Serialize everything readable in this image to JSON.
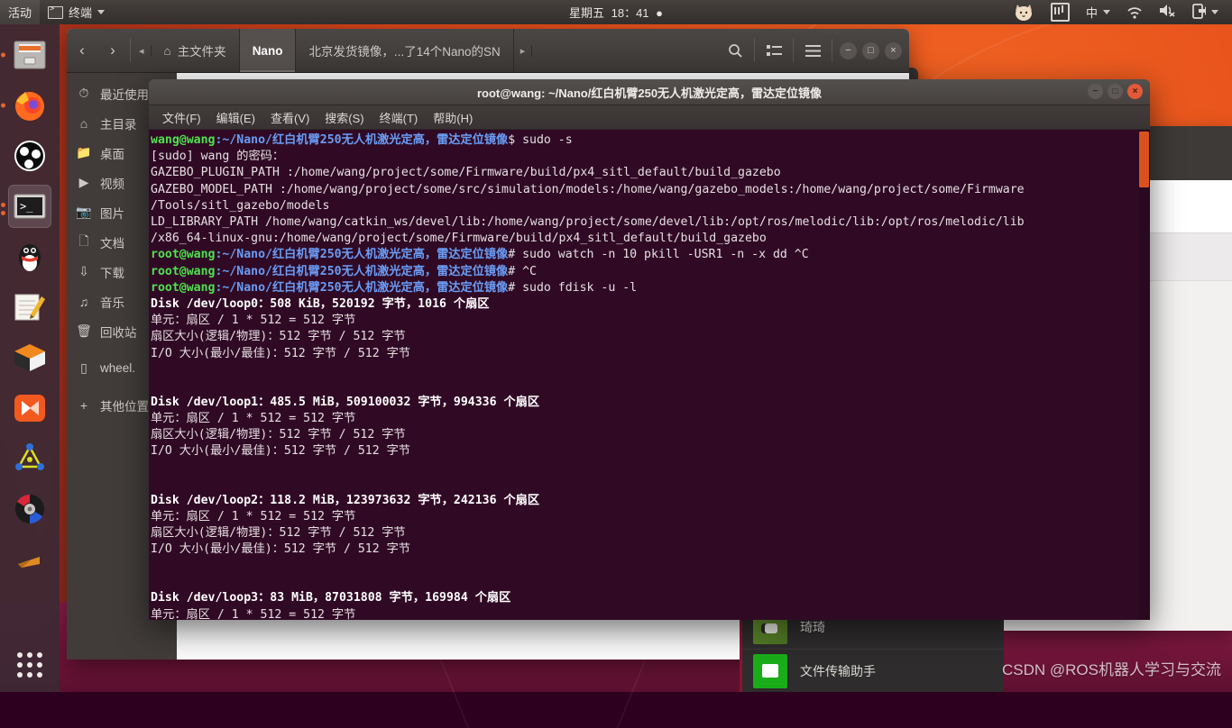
{
  "topbar": {
    "activities": "活动",
    "app_indicator": {
      "icon": "terminal-icon",
      "label": "终端"
    },
    "clock": {
      "weekday": "星期五",
      "time": "18：41"
    },
    "indicators": [
      {
        "name": "cat-tray-icon",
        "label": ""
      },
      {
        "name": "keyboard-layout-icon",
        "label": ""
      },
      {
        "name": "input-method-icon",
        "label": "中"
      },
      {
        "name": "wifi-icon",
        "label": ""
      },
      {
        "name": "volume-muted-icon",
        "label": ""
      },
      {
        "name": "power-menu-icon",
        "label": ""
      }
    ]
  },
  "dock": {
    "items": [
      {
        "name": "files-icon",
        "label": "文件管理器",
        "running": true
      },
      {
        "name": "firefox-icon",
        "label": "Firefox",
        "running": true
      },
      {
        "name": "obs-icon",
        "label": "OBS Studio",
        "running": false
      },
      {
        "name": "terminal-icon",
        "label": "终端",
        "running": true,
        "active": true
      },
      {
        "name": "qq-icon",
        "label": "QQ",
        "running": false
      },
      {
        "name": "notes-icon",
        "label": "备忘录",
        "running": false
      },
      {
        "name": "virtualbox-icon",
        "label": "VirtualBox",
        "running": false
      },
      {
        "name": "media-player-icon",
        "label": "影音先锋",
        "running": false
      },
      {
        "name": "molecule-icon",
        "label": "分子编辑器",
        "running": false
      },
      {
        "name": "disk-burner-icon",
        "label": "光盘刻录",
        "running": false
      },
      {
        "name": "unknown-app-icon",
        "label": "应用",
        "running": false
      }
    ],
    "show_apps": "显示应用程序"
  },
  "file_manager": {
    "nav": {
      "back": "‹",
      "forward": "›",
      "tabs_left": "◂",
      "tabs_right": "▸"
    },
    "tabs": [
      {
        "label": "主文件夹",
        "icon": "home-icon",
        "selected": false
      },
      {
        "label": "Nano",
        "icon": "",
        "selected": true
      },
      {
        "label": "北京发货镜像，...了14个Nano的SN",
        "icon": "",
        "selected": false
      }
    ],
    "toolbar": [
      {
        "name": "search-icon",
        "label": "搜索"
      },
      {
        "name": "view-list-icon",
        "label": "视图"
      },
      {
        "name": "hamburger-menu-icon",
        "label": "菜单"
      }
    ],
    "window_buttons": {
      "minimize": "−",
      "maximize": "□",
      "close": "×"
    },
    "sidebar": [
      {
        "icon": "recent-icon",
        "label": "最近使用"
      },
      {
        "icon": "home-icon",
        "label": "主目录"
      },
      {
        "icon": "desktop-icon",
        "label": "桌面"
      },
      {
        "icon": "video-icon",
        "label": "视频"
      },
      {
        "icon": "pictures-icon",
        "label": "图片"
      },
      {
        "icon": "documents-icon",
        "label": "文档"
      },
      {
        "icon": "downloads-icon",
        "label": "下载"
      },
      {
        "icon": "music-icon",
        "label": "音乐"
      },
      {
        "icon": "trash-icon",
        "label": "回收站"
      },
      {
        "icon": "drive-icon",
        "label": "wheel."
      },
      {
        "icon": "plus-icon",
        "label": "其他位置"
      }
    ]
  },
  "terminal": {
    "title": "root@wang: ~/Nano/红白机臂250无人机激光定高，雷达定位镜像",
    "window_buttons": {
      "minimize": "−",
      "maximize": "□",
      "close": "×"
    },
    "menus": [
      "文件(F)",
      "编辑(E)",
      "查看(V)",
      "搜索(S)",
      "终端(T)",
      "帮助(H)"
    ],
    "prompt_user": "wang@wang",
    "prompt_root": "root@wang",
    "prompt_path": ":~/Nano/",
    "prompt_path_cn": "红白机臂250无人机激光定高，雷达定位镜像",
    "lines": [
      {
        "type": "prompt-user",
        "user": "wang@wang",
        "sep": ":~/Nano/",
        "path": "红白机臂250无人机激光定高，雷达定位镜像",
        "tail": "$ sudo -s"
      },
      {
        "type": "out",
        "text": "[sudo] wang 的密码："
      },
      {
        "type": "out",
        "text": "GAZEBO_PLUGIN_PATH :/home/wang/project/some/Firmware/build/px4_sitl_default/build_gazebo"
      },
      {
        "type": "out",
        "text": "GAZEBO_MODEL_PATH :/home/wang/project/some/src/simulation/models:/home/wang/gazebo_models:/home/wang/project/some/Firmware"
      },
      {
        "type": "out",
        "text": "/Tools/sitl_gazebo/models"
      },
      {
        "type": "out",
        "text": "LD_LIBRARY_PATH /home/wang/catkin_ws/devel/lib:/home/wang/project/some/devel/lib:/opt/ros/melodic/lib:/opt/ros/melodic/lib"
      },
      {
        "type": "out",
        "text": "/x86_64-linux-gnu:/home/wang/project/some/Firmware/build/px4_sitl_default/build_gazebo"
      },
      {
        "type": "prompt-root",
        "user": "root@wang",
        "sep": ":~/Nano/",
        "path": "红白机臂250无人机激光定高，雷达定位镜像",
        "tail": "# sudo watch -n 10 pkill -USR1 -n -x dd ^C"
      },
      {
        "type": "prompt-root",
        "user": "root@wang",
        "sep": ":~/Nano/",
        "path": "红白机臂250无人机激光定高，雷达定位镜像",
        "tail": "# ^C"
      },
      {
        "type": "prompt-root",
        "user": "root@wang",
        "sep": ":~/Nano/",
        "path": "红白机臂250无人机激光定高，雷达定位镜像",
        "tail": "# sudo fdisk -u -l"
      },
      {
        "type": "bold",
        "text": "Disk /dev/loop0：508 KiB，520192 字节，1016 个扇区"
      },
      {
        "type": "out",
        "text": "单元：扇区 / 1 * 512 = 512 字节"
      },
      {
        "type": "out",
        "text": "扇区大小(逻辑/物理)：512 字节 / 512 字节"
      },
      {
        "type": "out",
        "text": "I/O 大小(最小/最佳)：512 字节 / 512 字节"
      },
      {
        "type": "blank",
        "text": ""
      },
      {
        "type": "blank",
        "text": ""
      },
      {
        "type": "bold",
        "text": "Disk /dev/loop1：485.5 MiB，509100032 字节，994336 个扇区"
      },
      {
        "type": "out",
        "text": "单元：扇区 / 1 * 512 = 512 字节"
      },
      {
        "type": "out",
        "text": "扇区大小(逻辑/物理)：512 字节 / 512 字节"
      },
      {
        "type": "out",
        "text": "I/O 大小(最小/最佳)：512 字节 / 512 字节"
      },
      {
        "type": "blank",
        "text": ""
      },
      {
        "type": "blank",
        "text": ""
      },
      {
        "type": "bold",
        "text": "Disk /dev/loop2：118.2 MiB，123973632 字节，242136 个扇区"
      },
      {
        "type": "out",
        "text": "单元：扇区 / 1 * 512 = 512 字节"
      },
      {
        "type": "out",
        "text": "扇区大小(逻辑/物理)：512 字节 / 512 字节"
      },
      {
        "type": "out",
        "text": "I/O 大小(最小/最佳)：512 字节 / 512 字节"
      },
      {
        "type": "blank",
        "text": ""
      },
      {
        "type": "blank",
        "text": ""
      },
      {
        "type": "bold",
        "text": "Disk /dev/loop3：83 MiB，87031808 字节，169984 个扇区"
      },
      {
        "type": "out",
        "text": "单元：扇区 / 1 * 512 = 512 字节"
      }
    ]
  },
  "wechat": {
    "contacts": [
      {
        "name": "琦琦",
        "avatar": "photo-avatar"
      },
      {
        "name": "文件传输助手",
        "avatar": "file-transfer-avatar"
      }
    ]
  },
  "watermark": "CSDN @ROS机器人学习与交流",
  "colors": {
    "accent": "#e8642b",
    "terminal_bg": "#300a24",
    "prompt_green": "#4ee24e",
    "prompt_blue": "#6a9cf5",
    "scrollbar": "#d9521e"
  }
}
